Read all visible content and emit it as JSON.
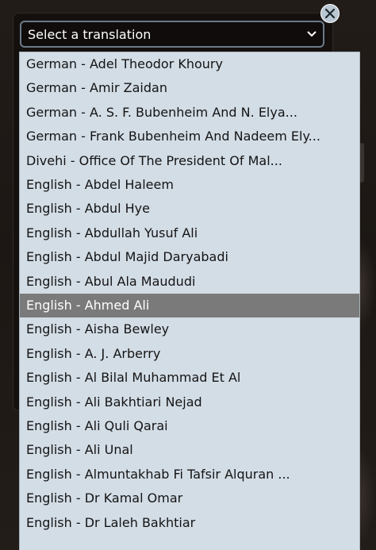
{
  "select": {
    "placeholder": "Select a translation",
    "chevron_icon": "chevron-down-icon"
  },
  "close_icon": "close-icon",
  "options": [
    {
      "label": "German - Adel Theodor Khoury",
      "selected": false
    },
    {
      "label": "German - Amir Zaidan",
      "selected": false
    },
    {
      "label": "German - A. S. F. Bubenheim And N. Elya...",
      "selected": false
    },
    {
      "label": "German - Frank Bubenheim And Nadeem Ely...",
      "selected": false
    },
    {
      "label": "Divehi - Office Of The President Of Mal...",
      "selected": false
    },
    {
      "label": "English - Abdel Haleem",
      "selected": false
    },
    {
      "label": "English - Abdul Hye",
      "selected": false
    },
    {
      "label": "English - Abdullah Yusuf Ali",
      "selected": false
    },
    {
      "label": "English - Abdul Majid Daryabadi",
      "selected": false
    },
    {
      "label": "English - Abul Ala Maududi",
      "selected": false
    },
    {
      "label": "English - Ahmed Ali",
      "selected": true
    },
    {
      "label": "English - Aisha Bewley",
      "selected": false
    },
    {
      "label": "English - A. J. Arberry",
      "selected": false
    },
    {
      "label": "English - Al Bilal Muhammad Et Al",
      "selected": false
    },
    {
      "label": "English - Ali Bakhtiari Nejad",
      "selected": false
    },
    {
      "label": "English - Ali Quli Qarai",
      "selected": false
    },
    {
      "label": "English - Ali Unal",
      "selected": false
    },
    {
      "label": "English - Almuntakhab Fi Tafsir Alquran ...",
      "selected": false
    },
    {
      "label": "English - Dr Kamal Omar",
      "selected": false
    },
    {
      "label": "English - Dr Laleh Bakhtiar",
      "selected": false
    }
  ],
  "colors": {
    "list_background": "#d3dde6",
    "highlight": "#7a7a7a",
    "modal_background": "#14100e",
    "select_border": "#6b7a88"
  }
}
